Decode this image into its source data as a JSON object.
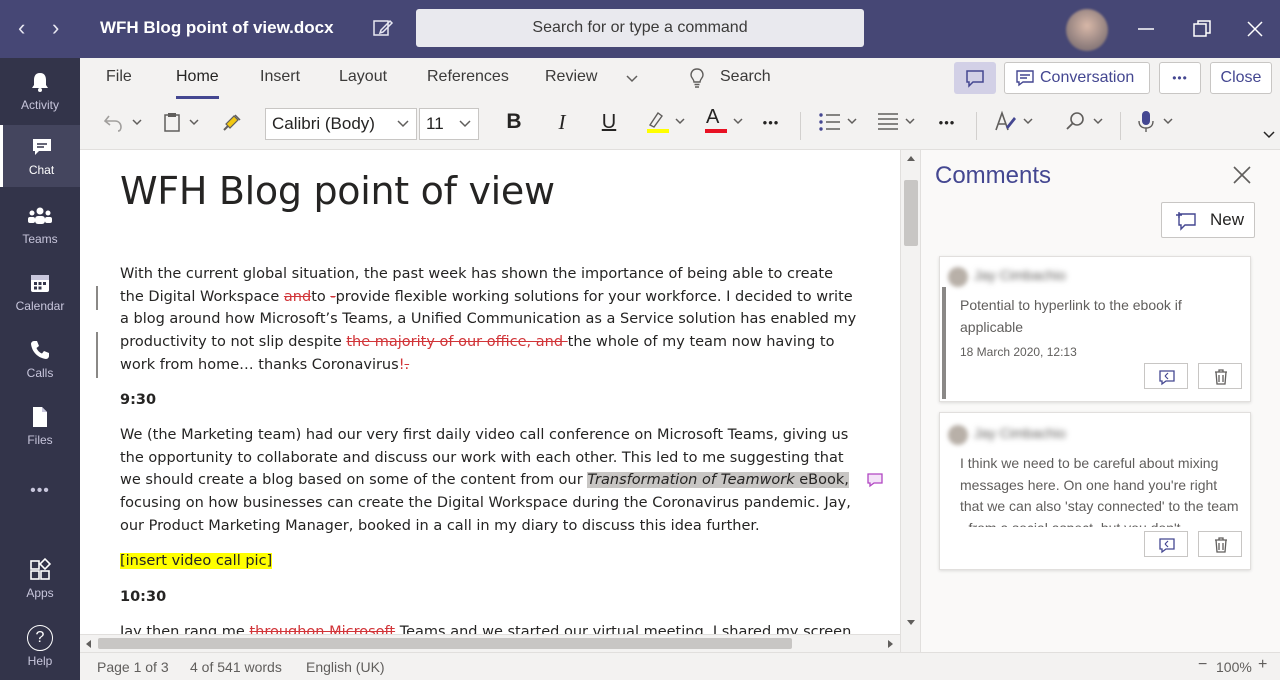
{
  "titlebar": {
    "back_glyph": "‹",
    "forward_glyph": "›",
    "doc_title": "WFH Blog point of view.docx",
    "search_placeholder": "Search for or type a command",
    "color": "#464775"
  },
  "rail": {
    "items": [
      {
        "label": "Activity",
        "icon": "bell-icon"
      },
      {
        "label": "Chat",
        "icon": "chat-icon",
        "active": true
      },
      {
        "label": "Teams",
        "icon": "teams-icon"
      },
      {
        "label": "Calendar",
        "icon": "calendar-icon"
      },
      {
        "label": "Calls",
        "icon": "phone-icon"
      },
      {
        "label": "Files",
        "icon": "file-icon"
      },
      {
        "label": "",
        "icon": "more-icon"
      },
      {
        "label": "Apps",
        "icon": "apps-icon"
      },
      {
        "label": "Help",
        "icon": "help-icon"
      }
    ],
    "more_glyph": "•••",
    "help_glyph": "?"
  },
  "ribbon": {
    "tabs": [
      "File",
      "Home",
      "Insert",
      "Layout",
      "References",
      "Review"
    ],
    "active_tab": "Home",
    "tell_me": "Search",
    "conversation_label": "Conversation",
    "more_label": "•••",
    "close_label": "Close",
    "font_name": "Calibri (Body)",
    "font_size": "11",
    "bold": "B",
    "italic": "I",
    "underline": "U",
    "font_color_glyph": "A",
    "more_glyph": "•••"
  },
  "document": {
    "title": "WFH Blog point of view",
    "p1": {
      "a": "With the current global situation, the past week has shown the importance of being able to create the Digital Workspace ",
      "del1": "and",
      "b": "to ",
      "del2": "-",
      "c": "provide flexible working solutions for your workforce. I decided to write a blog around how Microsoft’s Teams, a Unified Communication as a Service solution has enabled my productivity to not slip despite ",
      "del3": "the majority of our office, and ",
      "d": "the whole of my team now having to work from home… thanks Coronavirus",
      "ins": "!",
      "del4": "."
    },
    "time1": "9:30",
    "p2": {
      "a": "We (the Marketing team) had our very first daily video call conference on Microsoft Teams, giving us the opportunity to collaborate and discuss our work with each other. This led to me suggesting that we should create a blog based on some of the content from our ",
      "hl": "Transformation of Teamwork",
      "hl2": " eBook,",
      "b": " focusing on how businesses can create the Digital Workspace during the Coronavirus pandemic. Jay, our Product Marketing Manager, booked in a call in my diary to discuss this idea further."
    },
    "placeholder": "[insert video call pic]",
    "time2": "10:30",
    "p3": {
      "a": "Jay then rang me ",
      "del": "throughon Microsoft",
      "b": " Teams and we started our virtual meeting. I shared my screen"
    }
  },
  "comments": {
    "title": "Comments",
    "new_label": "New",
    "items": [
      {
        "author": "Jay Cimbachio",
        "body": "Potential to hyperlink to the ebook if applicable",
        "timestamp": "18 March 2020, 12:13"
      },
      {
        "author": "Jay Cimbachio",
        "body": "I think we need to be careful about mixing messages here.  On one hand you're right that we can also 'stay connected' to the team - from a social aspect, but you don't"
      }
    ]
  },
  "status": {
    "page": "Page 1 of 3",
    "words": "4 of 541 words",
    "language": "English (UK)",
    "zoom_out": "−",
    "zoom": "100%",
    "zoom_in": "+"
  }
}
